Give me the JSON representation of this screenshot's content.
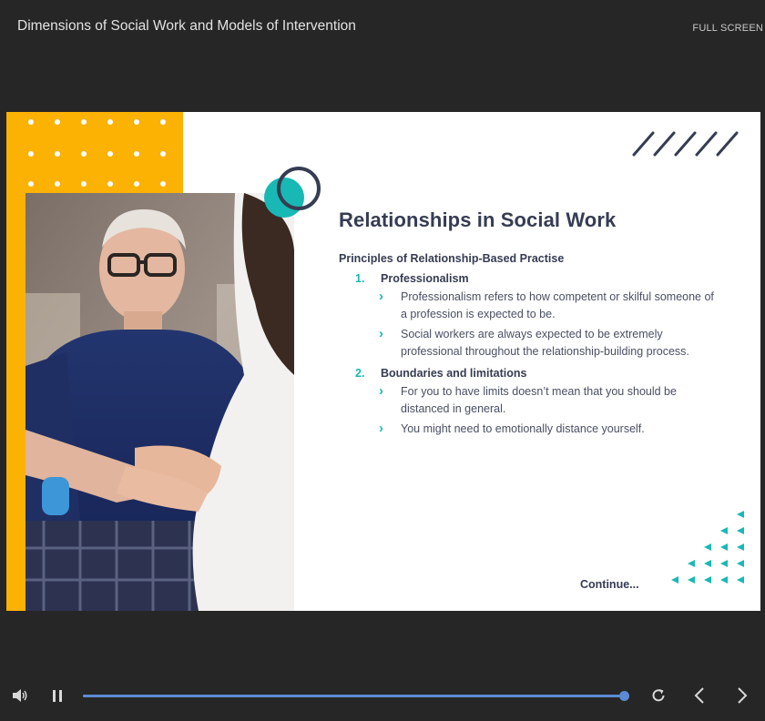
{
  "header": {
    "title": "Dimensions of Social Work and Models of Intervention",
    "fullscreen_label": "FULL SCREEN"
  },
  "slide": {
    "heading": "Relationships in Social Work",
    "subheading": "Principles of Relationship-Based Practise",
    "items": [
      {
        "num": "1.",
        "label": "Professionalism",
        "bullets": [
          "Professionalism refers to how competent or skilful someone of a profession is expected to be.",
          "Social workers are always expected to be extremely professional throughout the relationship-building process."
        ]
      },
      {
        "num": "2.",
        "label": "Boundaries and limitations",
        "bullets": [
          "For you to have limits doesn’t mean that you should be distanced in general.",
          "You might need to emotionally distance yourself."
        ]
      }
    ],
    "continue_label": "Continue...",
    "colors": {
      "accent": "#18b9b4",
      "yellow": "#fbb203",
      "navy": "#363c52"
    }
  },
  "player": {
    "progress": 0.99,
    "icons": [
      "volume-icon",
      "pause-icon",
      "replay-icon",
      "chevron-left-icon",
      "chevron-right-icon"
    ]
  }
}
